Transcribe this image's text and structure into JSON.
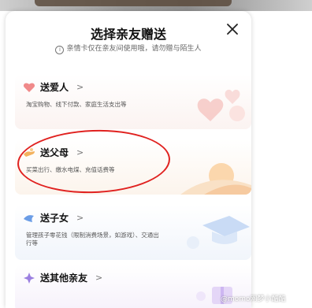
{
  "sheet": {
    "title": "选择亲友赠送",
    "subtitle": "亲情卡仅在亲友间使用哦，请勿赠与陌生人",
    "info_icon_glyph": "i",
    "close_icon": "close-icon"
  },
  "options": [
    {
      "title": "送爱人",
      "desc": "淘宝购物、线下付款、家庭生活支出等",
      "icon": "heart-icon",
      "accent": "#f08a8a"
    },
    {
      "title": "送父母",
      "desc": "买菜出行、缴水电煤、充值话费等",
      "icon": "hand-icon",
      "accent": "#f3b25e"
    },
    {
      "title": "送子女",
      "desc": "管理孩子零花钱（限制消费场景，如游戏）、交通出行等",
      "icon": "bird-icon",
      "accent": "#6b9de6"
    },
    {
      "title": "送其他亲友",
      "desc": "",
      "icon": "sparkle-icon",
      "accent": "#9b7fe0"
    }
  ],
  "chevron": ">",
  "watermark": "@momo网梦小酷酷",
  "annotation_color": "#e0211f"
}
